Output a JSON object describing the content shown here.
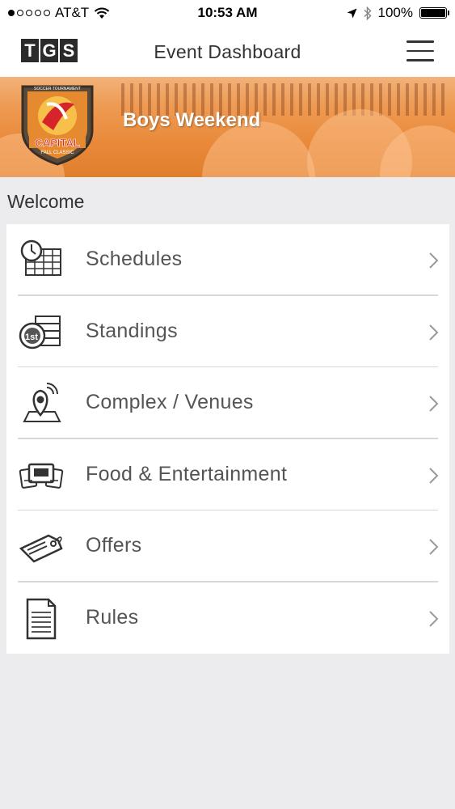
{
  "status_bar": {
    "carrier": "AT&T",
    "time": "10:53 AM",
    "battery": "100%"
  },
  "nav": {
    "logo_letters": [
      "T",
      "G",
      "S"
    ],
    "title": "Event Dashboard"
  },
  "banner": {
    "title": "Boys Weekend",
    "crest_text_main": "CAPITAL",
    "crest_text_sub": "FALL CLASSIC",
    "crest_text_top": "SOCCER TOURNAMENT"
  },
  "section": {
    "title": "Welcome"
  },
  "menu_items": [
    {
      "label": "Schedules",
      "icon": "schedule-icon"
    },
    {
      "label": "Standings",
      "icon": "standings-icon"
    },
    {
      "label": "Complex / Venues",
      "icon": "venue-map-icon"
    },
    {
      "label": "Food & Entertainment",
      "icon": "tickets-icon"
    },
    {
      "label": "Offers",
      "icon": "tag-icon"
    },
    {
      "label": "Rules",
      "icon": "document-icon"
    }
  ],
  "colors": {
    "banner_orange": "#e98a3a",
    "background": "#ececef",
    "text_dark": "#333333",
    "text_label": "#555555"
  }
}
